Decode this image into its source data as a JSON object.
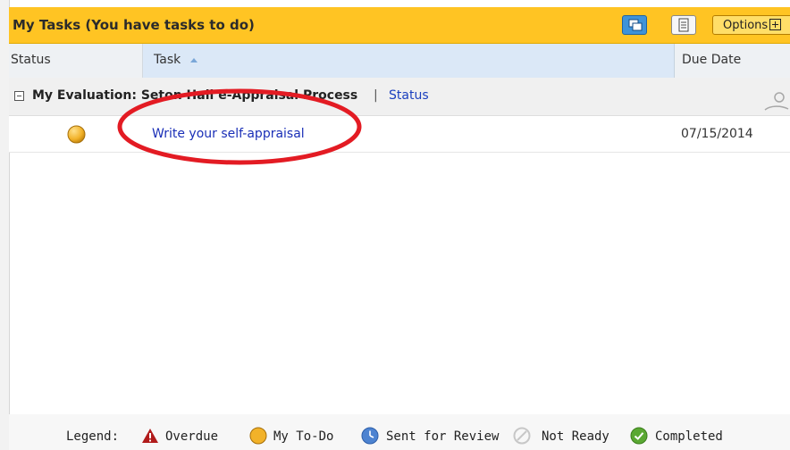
{
  "header": {
    "title": "My Tasks (You have tasks to do)",
    "options_label": "Options"
  },
  "columns": {
    "status": "Status",
    "task": "Task",
    "due_date": "Due Date"
  },
  "group": {
    "name": "My Evaluation: Seton Hall e-Appraisal Process",
    "separator": "|",
    "status_link": "Status"
  },
  "tasks": [
    {
      "status_icon": "todo-dot-icon",
      "title": "Write your self-appraisal",
      "due": "07/15/2014"
    }
  ],
  "legend": {
    "label": "Legend:",
    "items": [
      {
        "icon": "overdue-warning-icon",
        "label": "Overdue",
        "color": "#b11b1b"
      },
      {
        "icon": "todo-dot-icon",
        "label": "My To-Do",
        "color": "#f2b229"
      },
      {
        "icon": "clock-icon",
        "label": "Sent for Review",
        "color": "#4d83d1"
      },
      {
        "icon": "not-ready-icon",
        "label": "Not Ready",
        "color": "#c7c7c7"
      },
      {
        "icon": "completed-check-icon",
        "label": "Completed",
        "color": "#5aa832"
      }
    ]
  },
  "colors": {
    "header_bg": "#ffc423",
    "link": "#1a2fb7",
    "annotation": "#e31b23"
  }
}
